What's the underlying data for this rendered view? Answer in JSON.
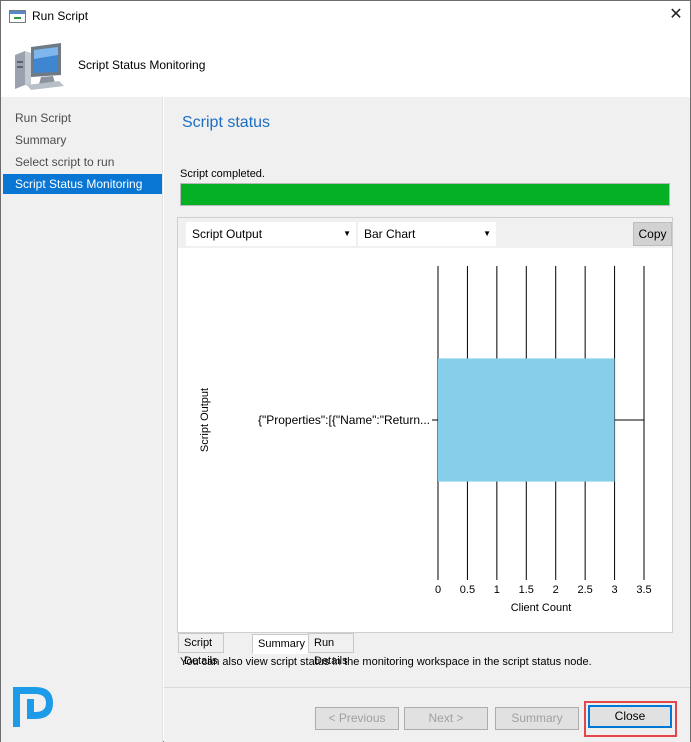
{
  "window": {
    "title": "Run Script"
  },
  "header": {
    "title": "Script Status Monitoring"
  },
  "nav": {
    "items": [
      {
        "label": "Run Script",
        "active": false
      },
      {
        "label": "Summary",
        "active": false
      },
      {
        "label": "Select script to run",
        "active": false
      },
      {
        "label": "Script Status Monitoring",
        "active": true
      }
    ]
  },
  "main": {
    "section_title": "Script status",
    "status_text": "Script completed.",
    "progress": 1.0,
    "progress_color": "#06b025"
  },
  "toolbar": {
    "output_select": "Script Output",
    "chart_select": "Bar Chart",
    "copy_label": "Copy"
  },
  "chart_data": {
    "type": "bar",
    "orientation": "horizontal",
    "categories": [
      "{\"Properties\":[{\"Name\":\"Return..."
    ],
    "values": [
      3
    ],
    "xlabel": "Client Count",
    "ylabel": "Script Output",
    "xlim": [
      0,
      3.5
    ],
    "xticks": [
      "0",
      "0.5",
      "1",
      "1.5",
      "2",
      "2.5",
      "3",
      "3.5"
    ],
    "grid": true,
    "bar_color": "#87ceeb"
  },
  "tabs": [
    {
      "label": "Script Details",
      "active": false
    },
    {
      "label": "Summary",
      "active": true
    },
    {
      "label": "Run Details",
      "active": false
    }
  ],
  "hint": "You can also view script status in the monitoring workspace in the script status node.",
  "footer": {
    "previous_label": "< Previous",
    "next_label": "Next >",
    "summary_label": "Summary",
    "close_label": "Close"
  },
  "icons": {
    "title_icon": "run-script-window-icon",
    "header_icon": "computer-monitor-icon",
    "close_icon": "close-icon",
    "brand_icon": "brand-logo-icon",
    "caret_icon": "dropdown-caret-icon"
  },
  "colors": {
    "accent": "#0a76d3",
    "section_title": "#1d6fc2",
    "highlight": "#e3474a"
  }
}
